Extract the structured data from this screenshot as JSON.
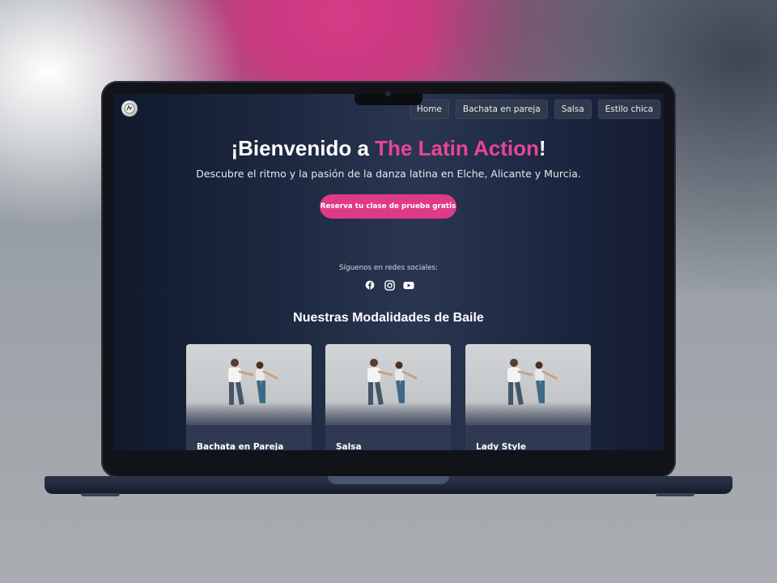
{
  "site": {
    "nav": [
      {
        "label": "Home"
      },
      {
        "label": "Bachata en pareja"
      },
      {
        "label": "Salsa"
      },
      {
        "label": "Estilo chica"
      }
    ],
    "hero": {
      "title_prefix": "¡Bienvenido a ",
      "title_accent": "The Latin Action",
      "title_suffix": "!",
      "subtitle": "Descubre el ritmo y la pasión de la danza latina en Elche, Alicante y Murcia.",
      "cta": "Reserva tu clase de prueba gratis"
    },
    "social": {
      "label": "Síguenos en redes sociales:",
      "icons": [
        "facebook-icon",
        "instagram-icon",
        "youtube-icon"
      ]
    },
    "modalities": {
      "title": "Nuestras Modalidades de Baile",
      "cards": [
        {
          "label": "Bachata en Pareja"
        },
        {
          "label": "Salsa"
        },
        {
          "label": "Lady Style"
        }
      ]
    }
  },
  "colors": {
    "accent": "#e94594",
    "button": "#de3a86",
    "nav_bg": "#303a4c",
    "screen_bg": "#1d2840"
  }
}
